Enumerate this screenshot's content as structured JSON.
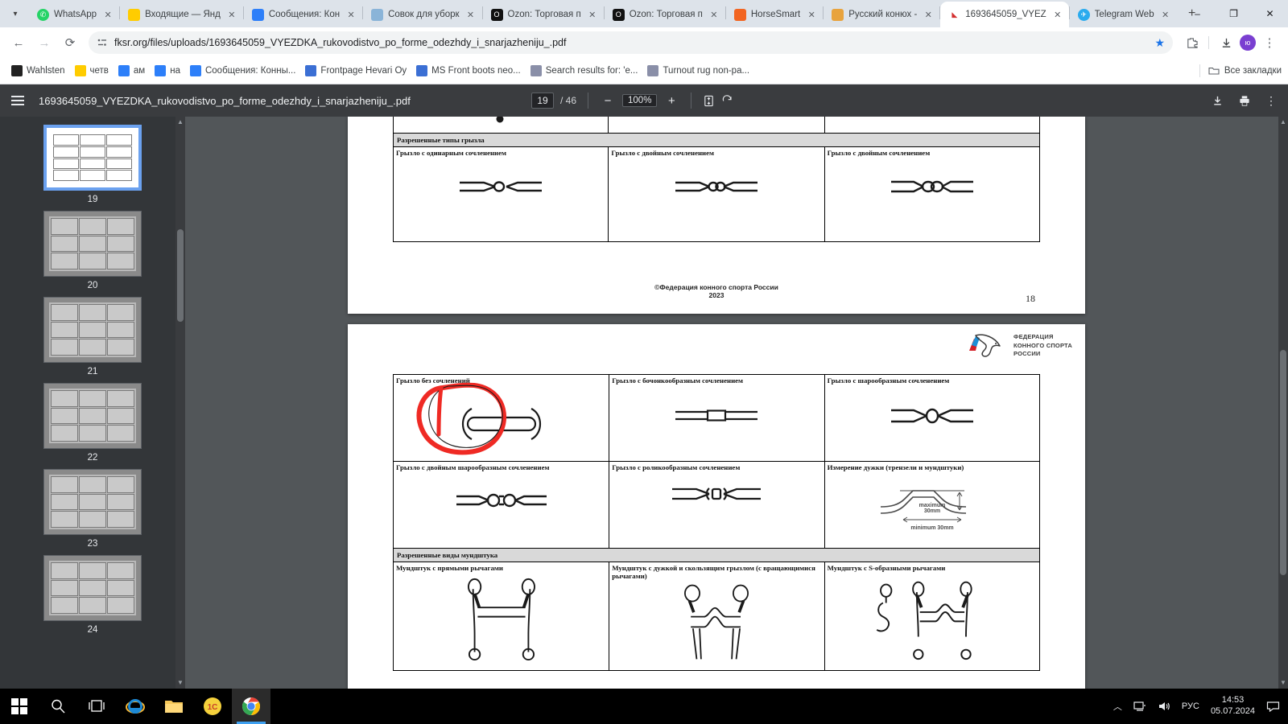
{
  "browser": {
    "tab_search_icon": "chevron-down-icon",
    "tabs": [
      {
        "label": "WhatsApp",
        "icon": "whatsapp-icon",
        "color": "#25D366",
        "active": false
      },
      {
        "label": "Входящие — Янд",
        "icon": "yandex-mail-icon",
        "color": "#FFCC00",
        "active": false
      },
      {
        "label": "Сообщения: Кон",
        "icon": "messages-icon",
        "color": "#2D7FF9",
        "active": false
      },
      {
        "label": "Совок для уборк",
        "icon": "shop-icon",
        "color": "#8AB4D8",
        "active": false
      },
      {
        "label": "Ozon: Торговая п",
        "icon": "ozon-icon",
        "color": "#0D0D0D",
        "active": false
      },
      {
        "label": "Ozon: Торговая п",
        "icon": "ozon-icon",
        "color": "#0D0D0D",
        "active": false
      },
      {
        "label": "HorseSmart",
        "icon": "horsesmart-icon",
        "color": "#F26522",
        "active": false
      },
      {
        "label": "Русский конюх -",
        "icon": "horse-icon",
        "color": "#E8A33D",
        "active": false
      },
      {
        "label": "1693645059_VYEZ",
        "icon": "pdf-fksr-icon",
        "color": "#D32F2F",
        "active": true
      },
      {
        "label": "Telegram Web",
        "icon": "telegram-icon",
        "color": "#2AABEE",
        "active": false
      }
    ],
    "new_tab_label": "+",
    "window_minimize": "–",
    "window_maximize": "❐",
    "window_close": "✕",
    "nav": {
      "back": "←",
      "forward": "→",
      "reload": "⟳",
      "site_info_icon": "page-info-icon",
      "url": "fksr.org/files/uploads/1693645059_VYEZDKA_rukovodistvo_po_forme_odezhdy_i_snarjazheniju_.pdf",
      "bookmark_star": "★",
      "extensions_icon": "puzzle-icon",
      "downloads_icon": "download-icon",
      "profile_initial": "ю",
      "profile_color": "#7a3fd1",
      "menu_icon": "three-dots-icon"
    },
    "bookmarks": [
      {
        "label": "Wahlsten",
        "icon": "wahlsten-icon",
        "color": "#222222"
      },
      {
        "label": "четв",
        "icon": "yandex-mail-icon",
        "color": "#FFCC00"
      },
      {
        "label": "ам",
        "icon": "messages-icon",
        "color": "#2D7FF9"
      },
      {
        "label": "на",
        "icon": "messages-icon",
        "color": "#2D7FF9"
      },
      {
        "label": "Сообщения: Конны...",
        "icon": "messages-icon",
        "color": "#2D7FF9"
      },
      {
        "label": "Frontpage Hevari Oy",
        "icon": "hevari-icon",
        "color": "#3B6FD4"
      },
      {
        "label": "MS Front boots neo...",
        "icon": "hevari-icon",
        "color": "#3B6FD4"
      },
      {
        "label": "Search results for: 'e...",
        "icon": "horse-icon",
        "color": "#8A8FA8"
      },
      {
        "label": "Turnout rug non-pa...",
        "icon": "horse-icon",
        "color": "#8A8FA8"
      }
    ],
    "all_bookmarks_label": "Все закладки",
    "all_bookmarks_icon": "folder-icon"
  },
  "pdf": {
    "menu_icon": "hamburger-icon",
    "title": "1693645059_VYEZDKA_rukovodistvo_po_forme_odezhdy_i_snarjazheniju_.pdf",
    "current_page": "19",
    "page_separator": "/ 46",
    "total_pages": "46",
    "zoom_out": "−",
    "zoom_level": "100%",
    "zoom_in": "+",
    "fit_icon": "fit-page-icon",
    "rotate_icon": "rotate-icon",
    "download_icon": "download-icon",
    "print_icon": "print-icon",
    "more_icon": "three-dots-icon",
    "thumbnails": [
      {
        "page": "19",
        "selected": true
      },
      {
        "page": "20",
        "selected": false
      },
      {
        "page": "21",
        "selected": false
      },
      {
        "page": "22",
        "selected": false
      },
      {
        "page": "23",
        "selected": false
      },
      {
        "page": "24",
        "selected": false
      }
    ]
  },
  "document": {
    "page18": {
      "section_header": "Разрешенные типы грызла",
      "cells": [
        {
          "title": "Грызло с одинарным сочленением",
          "art": "single-joint-bit"
        },
        {
          "title": "Грызло с двойным сочленением",
          "art": "double-joint-bit"
        },
        {
          "title": "Грызло с двойным сочленением",
          "art": "double-joint-bit-2"
        }
      ],
      "footer_line1": "©Федерация конного спорта России",
      "footer_line2": "2023",
      "page_number": "18"
    },
    "page19": {
      "logo": {
        "line1": "ФЕДЕРАЦИЯ",
        "line2": "КОННОГО СПОРТА",
        "line3": "РОССИИ",
        "icon": "fksr-horse-logo"
      },
      "row1": [
        {
          "title": "Грызло без сочленений",
          "art": "unjointed-bit",
          "annotated": true
        },
        {
          "title": "Грызло с бочонкообразным сочленением",
          "art": "barrel-joint-bit"
        },
        {
          "title": "Грызло с шарообразным сочленением",
          "art": "ball-joint-bit"
        }
      ],
      "row2": [
        {
          "title": "Грызло с двойным шарообразным сочленением",
          "art": "double-ball-joint-bit"
        },
        {
          "title": "Грызло с роликообразным сочленением",
          "art": "roller-joint-bit"
        },
        {
          "title": "Измерение дужки (трензели и мундштуки)",
          "art": "port-measure-diagram",
          "labels": {
            "max": "maximum\n30mm",
            "max_l1": "maximum",
            "max_l2": "30mm",
            "min": "minimum 30mm"
          }
        }
      ],
      "section_header": "Разрешенные виды мундштука",
      "row3": [
        {
          "title": "Мундштук с прямыми рычагами",
          "art": "straight-shank-curb"
        },
        {
          "title": "Мундштук с дужкой и скользящим грызлом (с вращающимися рычагами)",
          "art": "sliding-mouthpiece-curb"
        },
        {
          "title": "Мундштук с S-образными рычагами",
          "art": "s-shank-curb"
        }
      ],
      "annotation_color": "#ef2a24"
    }
  },
  "taskbar": {
    "items": [
      {
        "name": "start-button",
        "icon": "windows-logo-icon"
      },
      {
        "name": "search-button",
        "icon": "magnifier-icon"
      },
      {
        "name": "task-view-button",
        "icon": "task-view-icon"
      },
      {
        "name": "internet-explorer-button",
        "icon": "internet-explorer-icon"
      },
      {
        "name": "file-explorer-button",
        "icon": "folder-icon"
      },
      {
        "name": "1c-button",
        "icon": "1c-icon"
      },
      {
        "name": "chrome-button",
        "icon": "chrome-icon"
      }
    ],
    "tray": {
      "overflow_icon": "chevron-up-icon",
      "network_icon": "network-icon",
      "volume_icon": "speaker-icon",
      "language": "РУС",
      "time": "14:53",
      "date": "05.07.2024",
      "notifications_icon": "notification-icon"
    }
  }
}
